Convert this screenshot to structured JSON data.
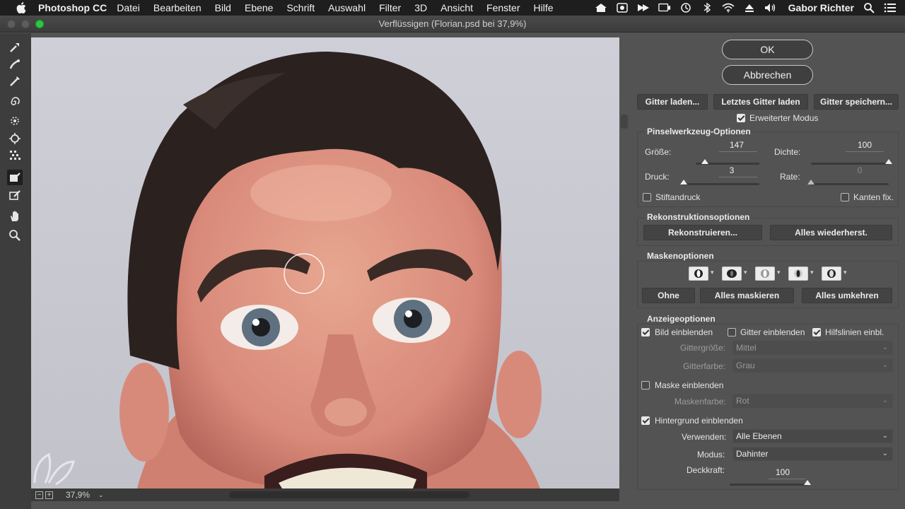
{
  "menubar": {
    "app_name": "Photoshop CC",
    "items": [
      "Datei",
      "Bearbeiten",
      "Bild",
      "Ebene",
      "Schrift",
      "Auswahl",
      "Filter",
      "3D",
      "Ansicht",
      "Fenster",
      "Hilfe"
    ],
    "user": "Gabor Richter"
  },
  "window": {
    "title": "Verflüssigen (Florian.psd bei 37,9%)"
  },
  "statusbar": {
    "zoom": "37,9%"
  },
  "buttons": {
    "ok": "OK",
    "cancel": "Abbrechen"
  },
  "mesh": {
    "load": "Gitter laden...",
    "load_last": "Letztes Gitter laden",
    "save": "Gitter speichern...",
    "advanced_mode": "Erweiterter Modus",
    "advanced_mode_checked": true
  },
  "brush_options": {
    "title": "Pinselwerkzeug-Optionen",
    "size_label": "Größe:",
    "size_value": "147",
    "size_fraction": 0.14,
    "density_label": "Dichte:",
    "density_value": "100",
    "density_fraction": 1.0,
    "pressure_label": "Druck:",
    "pressure_value": "3",
    "pressure_fraction": 0.03,
    "rate_label": "Rate:",
    "rate_value": "0",
    "rate_fraction": 0.0,
    "stylus_label": "Stiftandruck",
    "stylus_checked": false,
    "pin_edges_label": "Kanten fix.",
    "pin_edges_checked": false
  },
  "reconstruct": {
    "title": "Rekonstruktionsoptionen",
    "reconstruct_btn": "Rekonstruieren...",
    "restore_all_btn": "Alles wiederherst."
  },
  "mask": {
    "title": "Maskenoptionen",
    "none_btn": "Ohne",
    "mask_all_btn": "Alles maskieren",
    "invert_all_btn": "Alles umkehren"
  },
  "view": {
    "title": "Anzeigeoptionen",
    "show_image": "Bild einblenden",
    "show_image_checked": true,
    "show_mesh": "Gitter einblenden",
    "show_mesh_checked": false,
    "show_guides": "Hilfslinien einbl.",
    "show_guides_checked": true,
    "mesh_size_label": "Gittergröße:",
    "mesh_size_value": "Mittel",
    "mesh_color_label": "Gitterfarbe:",
    "mesh_color_value": "Grau",
    "show_mask": "Maske einblenden",
    "show_mask_checked": false,
    "mask_color_label": "Maskenfarbe:",
    "mask_color_value": "Rot",
    "show_backdrop": "Hintergrund einblenden",
    "show_backdrop_checked": true,
    "use_label": "Verwenden:",
    "use_value": "Alle Ebenen",
    "mode_label": "Modus:",
    "mode_value": "Dahinter",
    "opacity_label": "Deckkraft:",
    "opacity_value": "100",
    "opacity_fraction": 1.0
  }
}
